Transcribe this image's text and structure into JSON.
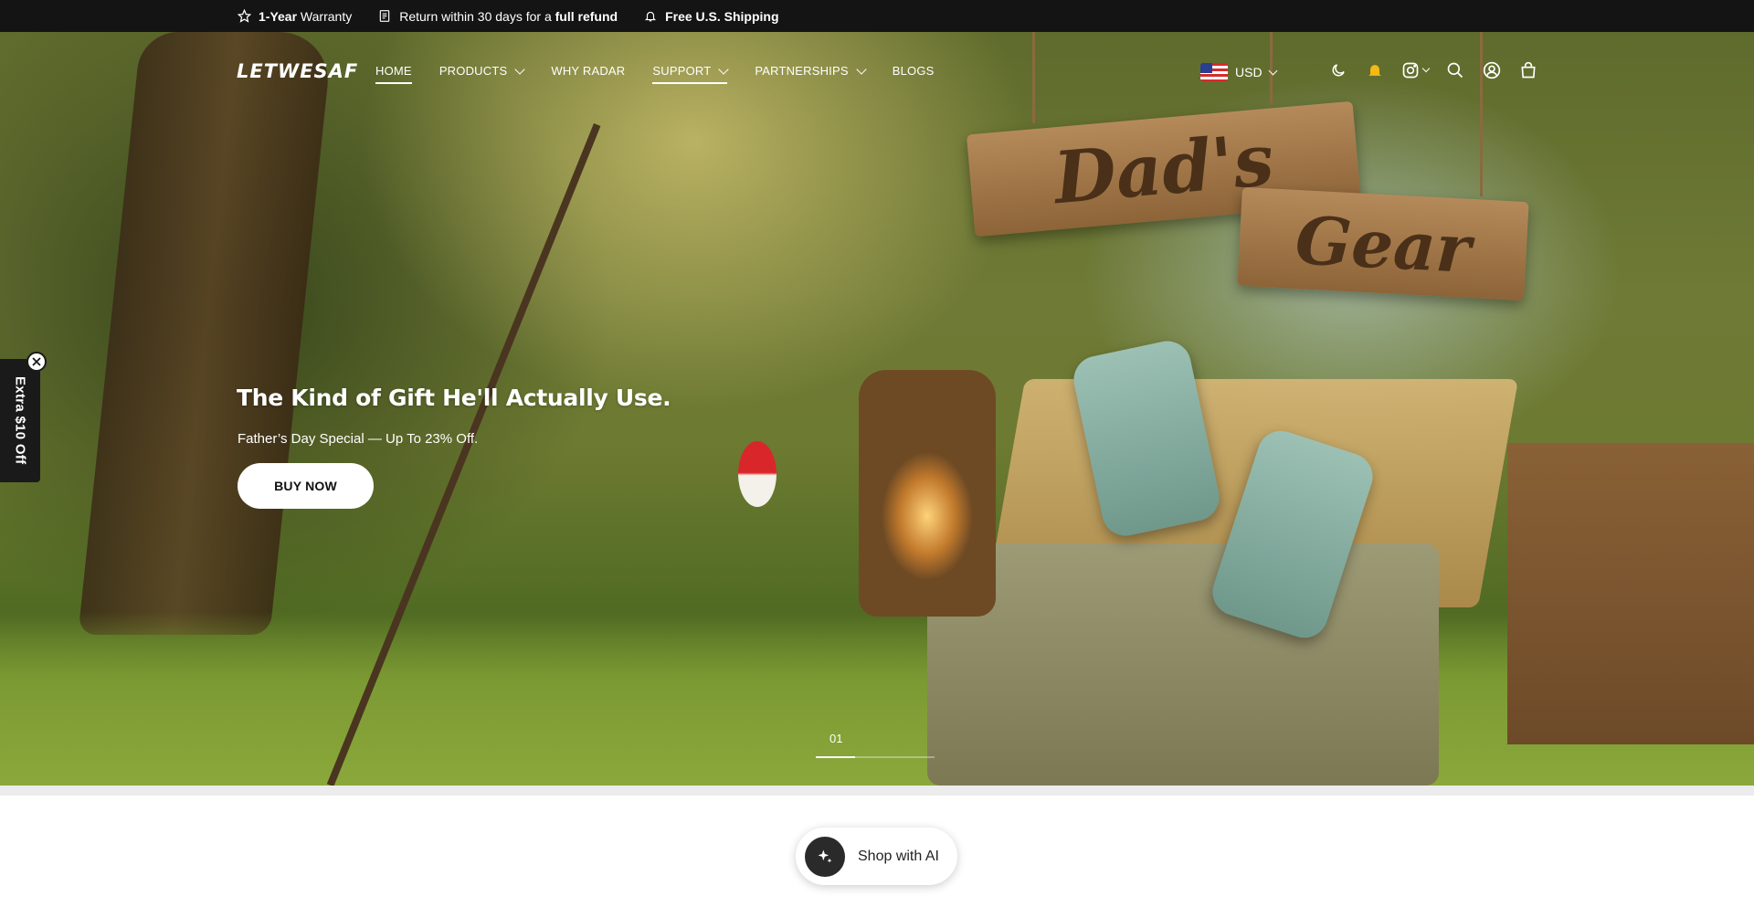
{
  "announcement": {
    "warranty_bold": "1-Year",
    "warranty_text": " Warranty",
    "return_text": "Return within 30 days for a ",
    "return_bold": "full refund",
    "shipping_bold": "Free U.S. Shipping"
  },
  "header": {
    "logo": "LETWESAF",
    "nav": [
      {
        "label": "HOME",
        "active": true
      },
      {
        "label": "PRODUCTS"
      },
      {
        "label": "WHY RADAR"
      },
      {
        "label": "SUPPORT"
      },
      {
        "label": "PARTNERSHIPS"
      },
      {
        "label": "BLOGS"
      }
    ],
    "currency": "USD",
    "icons": [
      "moon-icon",
      "bell-icon",
      "instagram-icon",
      "search-icon",
      "account-icon",
      "cart-icon"
    ]
  },
  "hero": {
    "sign_1": "Dad's",
    "sign_2": "Gear",
    "title": "The Kind of Gift He'll Actually Use.",
    "subtitle": "Father’s Day Special — Up To 23% Off.",
    "cta": "BUY NOW",
    "slide_number": "01",
    "slide_progress": 0.33
  },
  "side_tab": {
    "label": "Extra $10 Off"
  },
  "ai_button": {
    "label": "Shop with AI"
  },
  "colors": {
    "announcement_bg": "#141414",
    "bell_accent": "#f5b915",
    "side_tab_bg": "#1a1a1a"
  }
}
